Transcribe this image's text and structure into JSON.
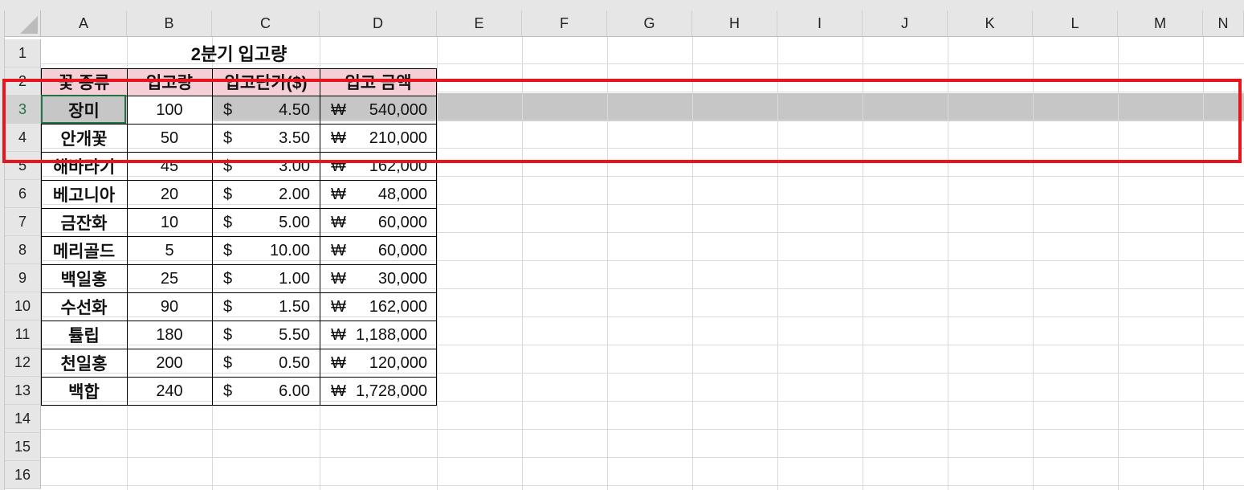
{
  "columns": [
    "A",
    "B",
    "C",
    "D",
    "E",
    "F",
    "G",
    "H",
    "I",
    "J",
    "K",
    "L",
    "M",
    "N"
  ],
  "rows": [
    "1",
    "2",
    "3",
    "4",
    "5",
    "6",
    "7",
    "8",
    "9",
    "10",
    "11",
    "12",
    "13",
    "14",
    "15",
    "16"
  ],
  "selected_row": "3",
  "sheet": {
    "title": "2분기 입고량",
    "headers": [
      "꽃 종류",
      "입고량",
      "입고단가($)",
      "입고 금액"
    ],
    "currency_symbol": "$",
    "won_symbol": "₩",
    "records": [
      {
        "name": "장미",
        "qty": "100",
        "price": "4.50",
        "amount": "540,000"
      },
      {
        "name": "안개꽃",
        "qty": "50",
        "price": "3.50",
        "amount": "210,000"
      },
      {
        "name": "해바라기",
        "qty": "45",
        "price": "3.00",
        "amount": "162,000"
      },
      {
        "name": "베고니아",
        "qty": "20",
        "price": "2.00",
        "amount": "48,000"
      },
      {
        "name": "금잔화",
        "qty": "10",
        "price": "5.00",
        "amount": "60,000"
      },
      {
        "name": "메리골드",
        "qty": "5",
        "price": "10.00",
        "amount": "60,000"
      },
      {
        "name": "백일홍",
        "qty": "25",
        "price": "1.00",
        "amount": "30,000"
      },
      {
        "name": "수선화",
        "qty": "90",
        "price": "1.50",
        "amount": "162,000"
      },
      {
        "name": "튤립",
        "qty": "180",
        "price": "5.50",
        "amount": "1,188,000"
      },
      {
        "name": "천일홍",
        "qty": "200",
        "price": "0.50",
        "amount": "120,000"
      },
      {
        "name": "백합",
        "qty": "240",
        "price": "6.00",
        "amount": "1,728,000"
      }
    ]
  },
  "colors": {
    "header_fill": "#f4cfd6",
    "selected_row": "#c6c6c6",
    "highlight_box": "#e8151f",
    "excel_green": "#217346"
  }
}
